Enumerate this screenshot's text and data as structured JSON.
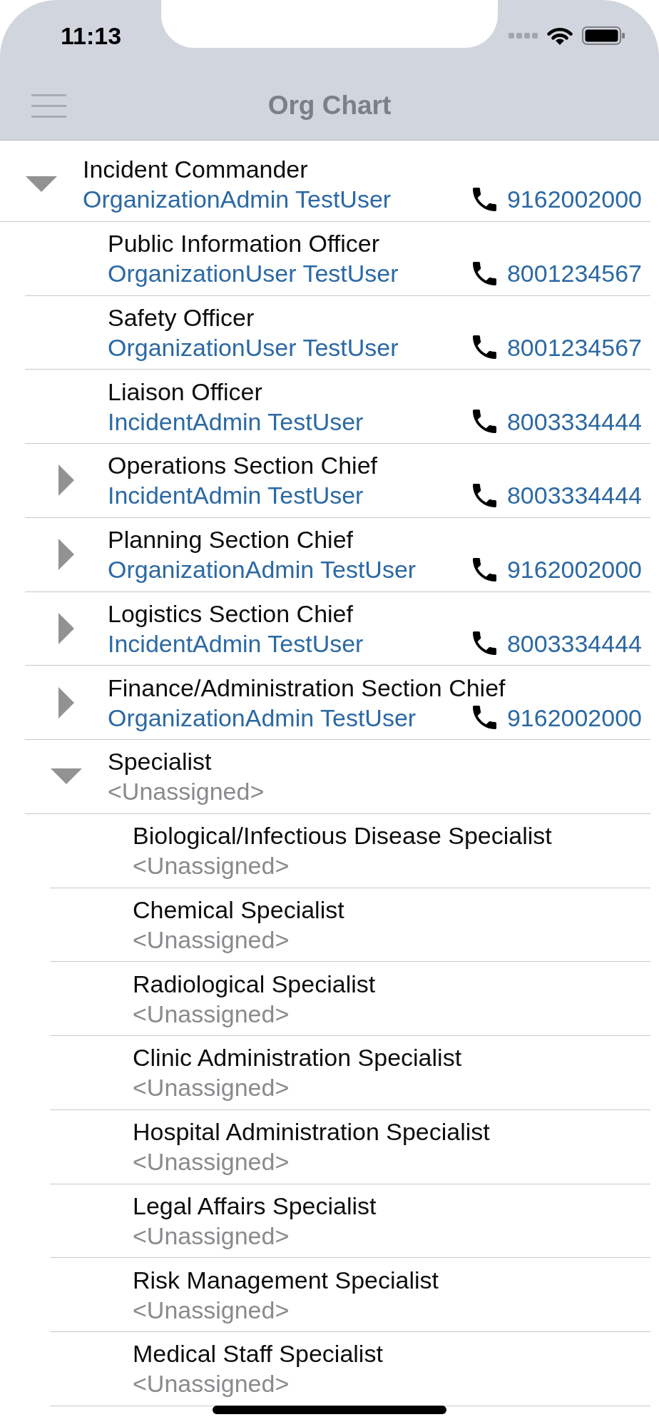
{
  "status_bar": {
    "time": "11:13"
  },
  "nav_bar": {
    "title": "Org Chart"
  },
  "org_tree": [
    {
      "title": "Incident Commander",
      "assignee": "OrganizationAdmin TestUser",
      "assigned": true,
      "phone": "9162002000",
      "expanded": true,
      "children": [
        {
          "title": "Public Information Officer",
          "assignee": "OrganizationUser TestUser",
          "assigned": true,
          "phone": "8001234567"
        },
        {
          "title": "Safety Officer",
          "assignee": "OrganizationUser TestUser",
          "assigned": true,
          "phone": "8001234567"
        },
        {
          "title": "Liaison Officer",
          "assignee": "IncidentAdmin TestUser",
          "assigned": true,
          "phone": "8003334444"
        },
        {
          "title": "Operations Section Chief",
          "assignee": "IncidentAdmin TestUser",
          "assigned": true,
          "phone": "8003334444",
          "expanded": false
        },
        {
          "title": "Planning Section Chief",
          "assignee": "OrganizationAdmin TestUser",
          "assigned": true,
          "phone": "9162002000",
          "expanded": false
        },
        {
          "title": "Logistics Section Chief",
          "assignee": "IncidentAdmin TestUser",
          "assigned": true,
          "phone": "8003334444",
          "expanded": false
        },
        {
          "title": "Finance/Administration Section Chief",
          "assignee": "OrganizationAdmin TestUser",
          "assigned": true,
          "phone": "9162002000",
          "expanded": false
        },
        {
          "title": "Specialist",
          "assignee": "<Unassigned>",
          "assigned": false,
          "expanded": true,
          "children": [
            {
              "title": "Biological/Infectious Disease Specialist",
              "assignee": "<Unassigned>",
              "assigned": false
            },
            {
              "title": "Chemical Specialist",
              "assignee": "<Unassigned>",
              "assigned": false
            },
            {
              "title": "Radiological Specialist",
              "assignee": "<Unassigned>",
              "assigned": false
            },
            {
              "title": "Clinic Administration Specialist",
              "assignee": "<Unassigned>",
              "assigned": false
            },
            {
              "title": "Hospital Administration Specialist",
              "assignee": "<Unassigned>",
              "assigned": false
            },
            {
              "title": "Legal Affairs Specialist",
              "assignee": "<Unassigned>",
              "assigned": false
            },
            {
              "title": "Risk Management Specialist",
              "assignee": "<Unassigned>",
              "assigned": false
            },
            {
              "title": "Medical Staff Specialist",
              "assignee": "<Unassigned>",
              "assigned": false
            }
          ]
        }
      ]
    }
  ]
}
